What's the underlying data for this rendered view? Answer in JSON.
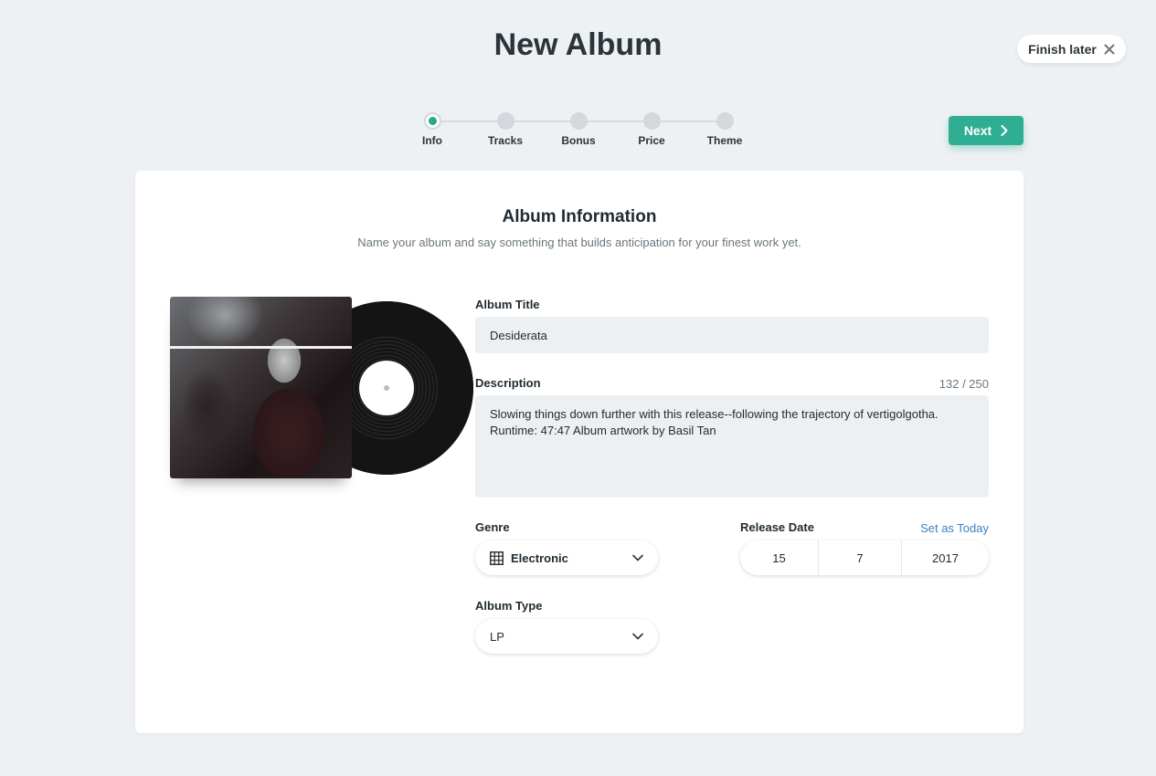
{
  "header": {
    "title": "New Album",
    "finish_later_label": "Finish later"
  },
  "stepper": {
    "steps": [
      {
        "label": "Info",
        "active": true
      },
      {
        "label": "Tracks",
        "active": false
      },
      {
        "label": "Bonus",
        "active": false
      },
      {
        "label": "Price",
        "active": false
      },
      {
        "label": "Theme",
        "active": false
      }
    ],
    "next_label": "Next"
  },
  "card": {
    "title": "Album Information",
    "subtitle": "Name your album and say something that builds anticipation for your finest work yet.",
    "album_title": {
      "label": "Album Title",
      "value": "Desiderata"
    },
    "description": {
      "label": "Description",
      "value": "Slowing things down further with this release--following the trajectory of vertigolgotha.\nRuntime: 47:47 Album artwork by Basil Tan",
      "count": "132 / 250"
    },
    "genre": {
      "label": "Genre",
      "value": "Electronic",
      "icon": "grid-icon"
    },
    "release_date": {
      "label": "Release Date",
      "set_today_label": "Set as Today",
      "day": "15",
      "month": "7",
      "year": "2017"
    },
    "album_type": {
      "label": "Album Type",
      "value": "LP"
    }
  },
  "colors": {
    "accent": "#2fae93",
    "link": "#3b82c4",
    "background": "#eef1f4"
  }
}
